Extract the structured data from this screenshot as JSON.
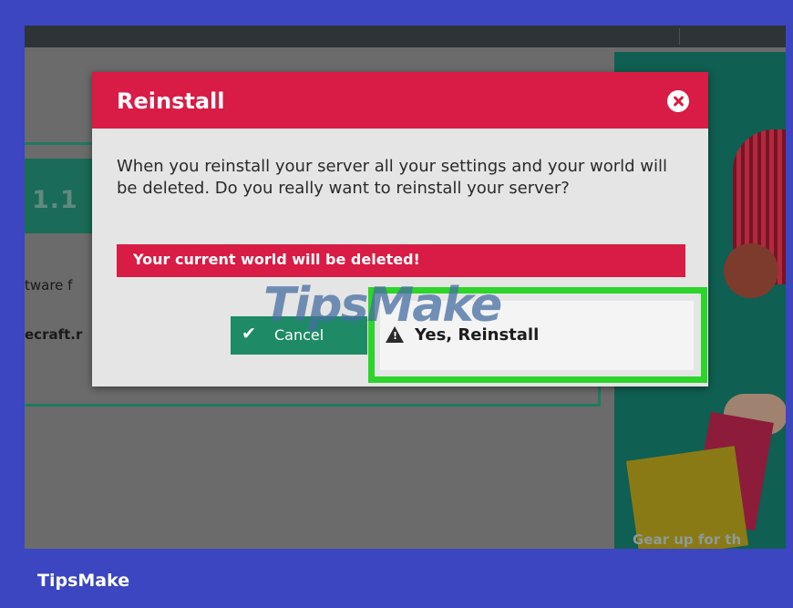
{
  "background": {
    "frame_color": "#3b46c0",
    "overlay_color": "#6b6b6b"
  },
  "page": {
    "version_text": "1.1",
    "side_text_1": "tware f",
    "side_text_2": "ecraft.r"
  },
  "ad": {
    "text": "Gear up for th"
  },
  "dialog": {
    "title": "Reinstall",
    "header_color": "#d81c45",
    "close_icon": "close-circle-icon",
    "message": "When you reinstall your server all your settings and your world will be deleted. Do you really want to reinstall your server?",
    "warning": "Your current world will be deleted!",
    "cancel_label": "Cancel",
    "cancel_icon": "checkmark-icon",
    "confirm_label": "Yes, Reinstall",
    "confirm_icon": "warning-triangle-icon",
    "highlight_color": "#2dd42a"
  },
  "watermark": "TipsMake",
  "brand": "TipsMake"
}
